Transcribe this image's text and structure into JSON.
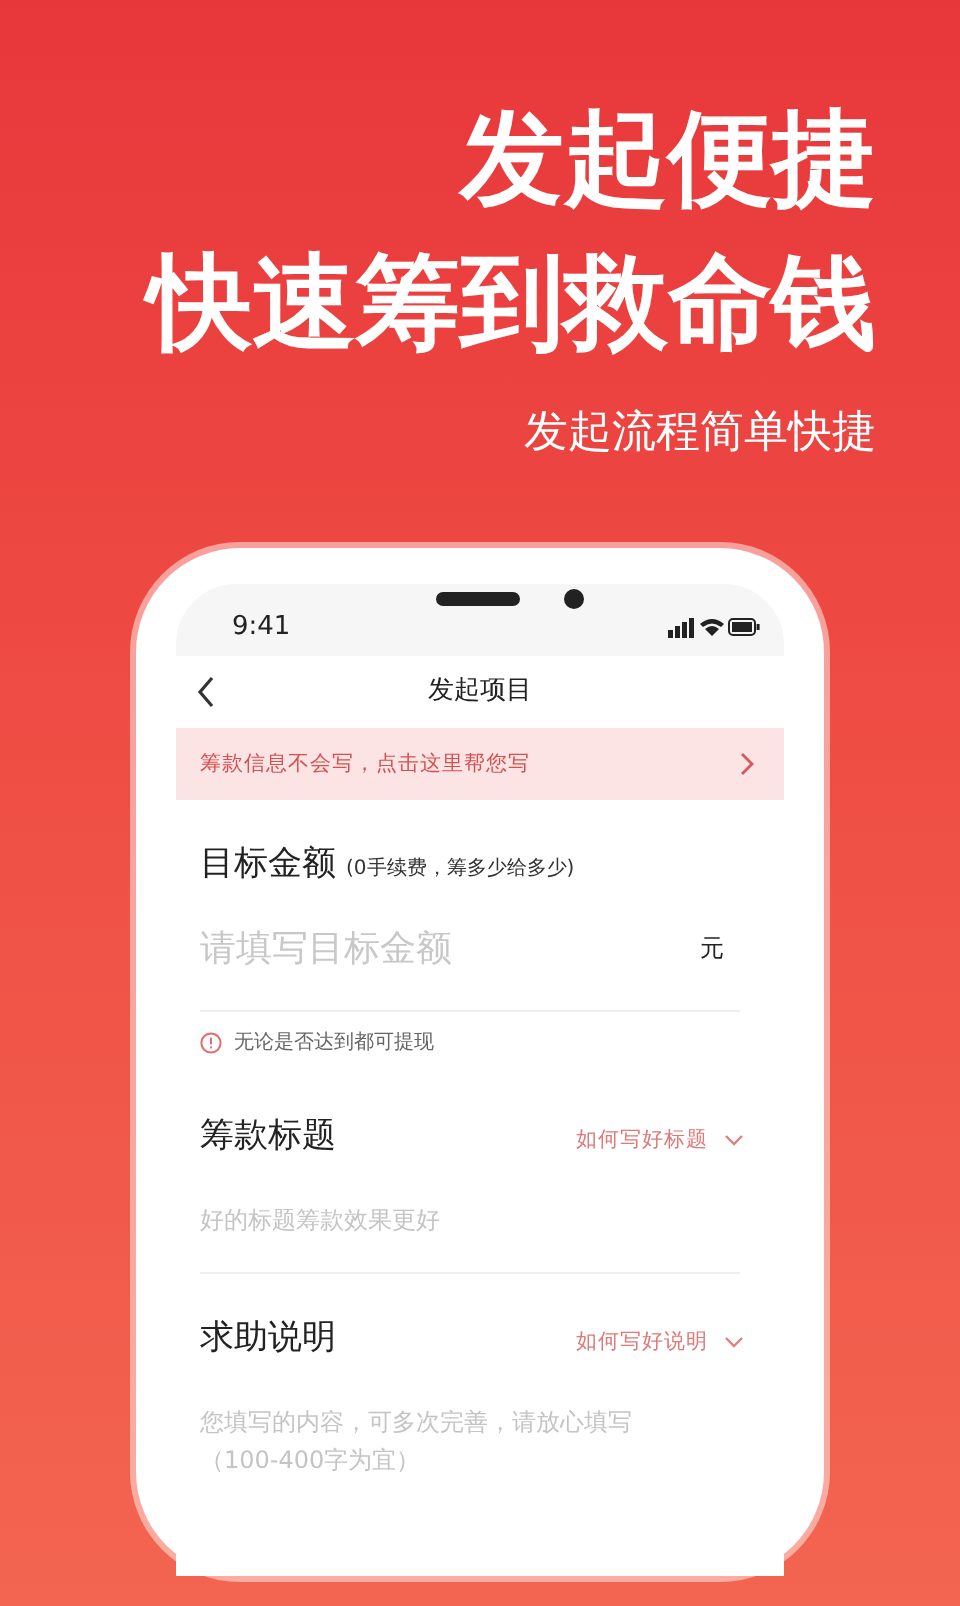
{
  "promo": {
    "headline": [
      "发起便捷",
      "快速筹到救命钱"
    ],
    "subtitle": "发起流程简单快捷"
  },
  "status_bar": {
    "time": "9:41"
  },
  "nav": {
    "title": "发起项目"
  },
  "banner": {
    "text": "筹款信息不会写，点击这里帮您写"
  },
  "sections": [
    {
      "kind": "amount",
      "title": "目标金额",
      "note": "(0手续费，筹多少给多少)",
      "placeholder": "请填写目标金额",
      "unit": "元",
      "hint": "无论是否达到都可提现"
    },
    {
      "kind": "text",
      "title": "筹款标题",
      "link": "如何写好标题",
      "placeholder": "好的标题筹款效果更好"
    },
    {
      "kind": "text",
      "title": "求助说明",
      "link": "如何写好说明",
      "placeholder": "您填写的内容，可多次完善，请放心填写（100-400字为宜）"
    }
  ]
}
